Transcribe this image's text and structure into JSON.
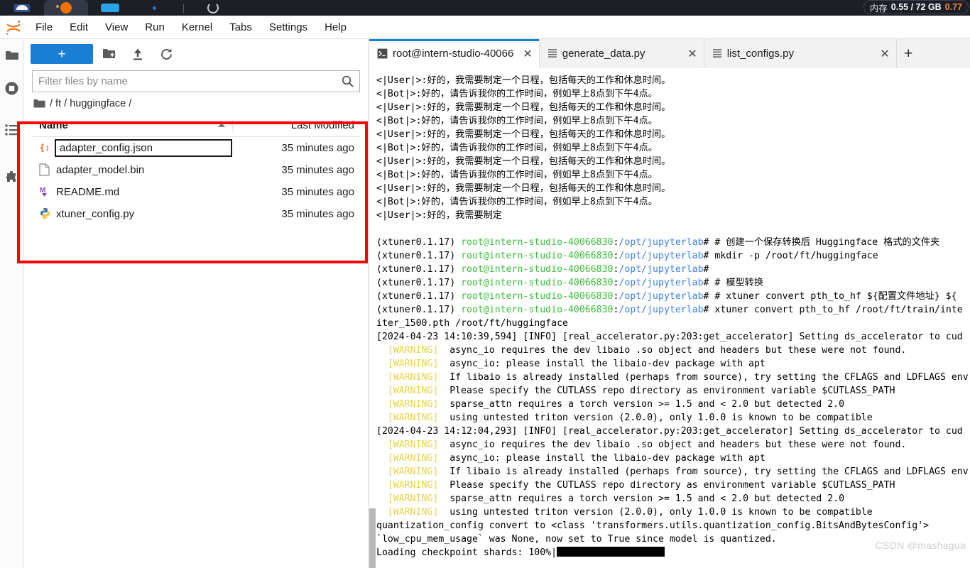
{
  "os_bar": {
    "tabs": [
      {
        "icon": "book-favicon",
        "active": false
      },
      {
        "icon": "orange-circle-favicon",
        "active": true
      },
      {
        "icon": "blue-rect-favicon",
        "active": false
      },
      {
        "icon": "blue-dot-favicon",
        "active": false
      },
      {
        "icon": "loading-ring-favicon",
        "active": false
      }
    ],
    "memory": {
      "label": "内存",
      "value": "0.55 / 72 GB",
      "percent": "0.77"
    }
  },
  "menubar": {
    "logo_name": "jupyter-logo",
    "items": [
      {
        "label": "File"
      },
      {
        "label": "Edit"
      },
      {
        "label": "View"
      },
      {
        "label": "Run"
      },
      {
        "label": "Kernel"
      },
      {
        "label": "Tabs"
      },
      {
        "label": "Settings"
      },
      {
        "label": "Help"
      }
    ]
  },
  "activitybar": {
    "items": [
      {
        "name": "file-browser-icon",
        "active": true
      },
      {
        "name": "running-terminals-icon",
        "active": false
      },
      {
        "name": "table-of-contents-icon",
        "active": false
      },
      {
        "name": "extension-manager-icon",
        "active": false
      }
    ]
  },
  "filebrowser": {
    "new_launcher_label": "+",
    "toolbar": [
      {
        "name": "new-folder-icon"
      },
      {
        "name": "upload-icon"
      },
      {
        "name": "refresh-icon"
      }
    ],
    "filter": {
      "placeholder": "Filter files by name",
      "value": ""
    },
    "breadcrumb": "/ ft / huggingface /",
    "columns": {
      "name": "Name",
      "last_modified": "Last Modified"
    },
    "sort": "ascending",
    "files": [
      {
        "name": "adapter_config.json",
        "icon": "json-file-icon",
        "modified": "35 minutes ago",
        "renaming": true
      },
      {
        "name": "adapter_model.bin",
        "icon": "generic-file-icon",
        "modified": "35 minutes ago",
        "renaming": false
      },
      {
        "name": "README.md",
        "icon": "markdown-file-icon",
        "modified": "35 minutes ago",
        "renaming": false
      },
      {
        "name": "xtuner_config.py",
        "icon": "python-file-icon",
        "modified": "35 minutes ago",
        "renaming": false
      }
    ]
  },
  "editor": {
    "tabs": [
      {
        "label": "root@intern-studio-40066",
        "icon": "terminal-icon",
        "active": true,
        "close": "✕"
      },
      {
        "label": "generate_data.py",
        "icon": "text-file-icon",
        "active": false,
        "close": "✕"
      },
      {
        "label": "list_configs.py",
        "icon": "text-file-icon",
        "active": false,
        "close": "✕"
      }
    ],
    "add_tab_label": "+"
  },
  "terminal": {
    "prompt": {
      "env": "(xtuner0.1.17) ",
      "user_host": "root@intern-studio-40066830",
      "colon": ":",
      "path": "/opt/jupyterlab",
      "hash": "# "
    },
    "dialogue": [
      "<|User|>:好的，我需要制定一个日程，包括每天的工作和休息时间。",
      "<|Bot|>:好的，请告诉我你的工作时间，例如早上8点到下午4点。",
      "<|User|>:好的，我需要制定一个日程，包括每天的工作和休息时间。",
      "<|Bot|>:好的，请告诉我你的工作时间，例如早上8点到下午4点。",
      "<|User|>:好的，我需要制定一个日程，包括每天的工作和休息时间。",
      "<|Bot|>:好的，请告诉我你的工作时间，例如早上8点到下午4点。",
      "<|User|>:好的，我需要制定一个日程，包括每天的工作和休息时间。",
      "<|Bot|>:好的，请告诉我你的工作时间，例如早上8点到下午4点。",
      "<|User|>:好的，我需要制定一个日程，包括每天的工作和休息时间。",
      "<|Bot|>:好的，请告诉我你的工作时间，例如早上8点到下午4点。",
      "<|User|>:好的，我需要制定"
    ],
    "commands": [
      "# 创建一个保存转换后 Huggingface 格式的文件夹",
      "mkdir -p /root/ft/huggingface",
      "",
      "# 模型转换",
      "# xtuner convert pth_to_hf ${配置文件地址} ${",
      "xtuner convert pth_to_hf /root/ft/train/inte"
    ],
    "continuation": "iter_1500.pth /root/ft/huggingface",
    "log": [
      {
        "type": "info",
        "text": "[2024-04-23 14:10:39,594] [INFO] [real_accelerator.py:203:get_accelerator] Setting ds_accelerator to cud"
      },
      {
        "type": "warning",
        "tag": "[WARNING]",
        "text": "async_io requires the dev libaio .so object and headers but these were not found."
      },
      {
        "type": "warning",
        "tag": "[WARNING]",
        "text": "async_io: please install the libaio-dev package with apt"
      },
      {
        "type": "warning",
        "tag": "[WARNING]",
        "text": "If libaio is already installed (perhaps from source), try setting the CFLAGS and LDFLAGS env"
      },
      {
        "type": "warning",
        "tag": "[WARNING]",
        "text": "Please specify the CUTLASS repo directory as environment variable $CUTLASS_PATH"
      },
      {
        "type": "warning",
        "tag": "[WARNING]",
        "text": "sparse_attn requires a torch version >= 1.5 and < 2.0 but detected 2.0"
      },
      {
        "type": "warning",
        "tag": "[WARNING]",
        "text": "using untested triton version (2.0.0), only 1.0.0 is known to be compatible"
      },
      {
        "type": "info",
        "text": "[2024-04-23 14:12:04,293] [INFO] [real_accelerator.py:203:get_accelerator] Setting ds_accelerator to cud"
      },
      {
        "type": "warning",
        "tag": "[WARNING]",
        "text": "async_io requires the dev libaio .so object and headers but these were not found."
      },
      {
        "type": "warning",
        "tag": "[WARNING]",
        "text": "async_io: please install the libaio-dev package with apt"
      },
      {
        "type": "warning",
        "tag": "[WARNING]",
        "text": "If libaio is already installed (perhaps from source), try setting the CFLAGS and LDFLAGS env"
      },
      {
        "type": "warning",
        "tag": "[WARNING]",
        "text": "Please specify the CUTLASS repo directory as environment variable $CUTLASS_PATH"
      },
      {
        "type": "warning",
        "tag": "[WARNING]",
        "text": "sparse_attn requires a torch version >= 1.5 and < 2.0 but detected 2.0"
      },
      {
        "type": "warning",
        "tag": "[WARNING]",
        "text": "using untested triton version (2.0.0), only 1.0.0 is known to be compatible"
      },
      {
        "type": "plain",
        "text": "quantization_config convert to <class 'transformers.utils.quantization_config.BitsAndBytesConfig'>"
      },
      {
        "type": "plain",
        "text": "`low_cpu_mem_usage` was None, now set to True since model is quantized."
      }
    ],
    "progress_line": "Loading checkpoint shards: 100%|"
  },
  "watermark": "CSDN @mashagua",
  "colors": {
    "accent": "#1a7fd4",
    "annotation_red": "#ff0000",
    "prompt_green": "#3bbd3b",
    "prompt_blue": "#3c7fe8",
    "warning_yellow": "#e8d44d"
  }
}
